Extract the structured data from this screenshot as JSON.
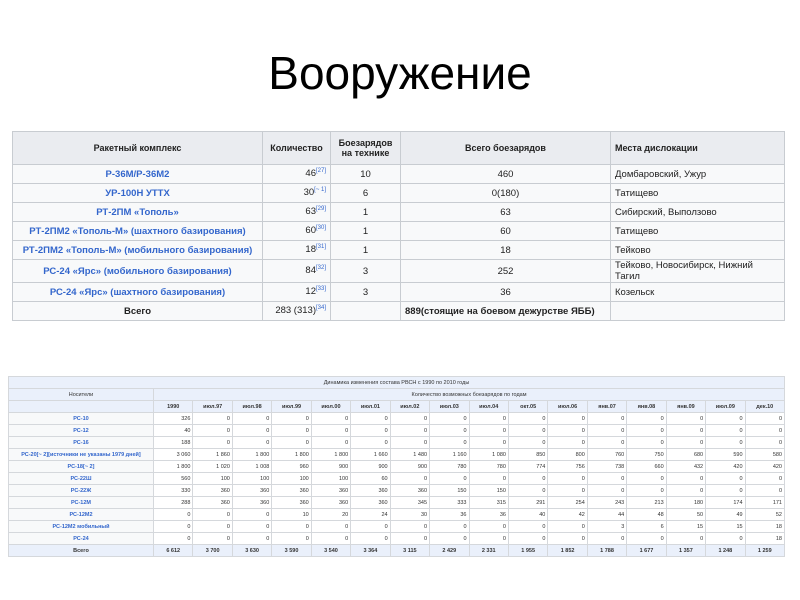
{
  "title": "Вооружение",
  "table1": {
    "headers": [
      "Ракетный комплекс",
      "Количество",
      "Боезарядов на технике",
      "Всего боезарядов",
      "Места дислокации"
    ],
    "rows": [
      {
        "name": "Р-36М/Р-36М2",
        "qty": "46",
        "ref": "[27]",
        "per": "10",
        "total": "460",
        "loc": "Домбаровский, Ужур"
      },
      {
        "name": "УР-100Н УТТХ",
        "qty": "30",
        "ref": "[~ 1]",
        "per": "6",
        "total": "0(180)",
        "loc": "Татищево"
      },
      {
        "name": "РТ-2ПМ «Тополь»",
        "qty": "63",
        "ref": "[29]",
        "per": "1",
        "total": "63",
        "loc": "Сибирский, Выползово"
      },
      {
        "name": "РТ-2ПМ2 «Тополь-М» (шахтного базирования)",
        "qty": "60",
        "ref": "[30]",
        "per": "1",
        "total": "60",
        "loc": "Татищево"
      },
      {
        "name": "РТ-2ПМ2 «Тополь-М» (мобильного базирования)",
        "qty": "18",
        "ref": "[31]",
        "per": "1",
        "total": "18",
        "loc": "Тейково"
      },
      {
        "name": "РС-24 «Ярс» (мобильного базирования)",
        "qty": "84",
        "ref": "[32]",
        "per": "3",
        "total": "252",
        "loc": "Тейково, Новосибирск, Нижний Тагил"
      },
      {
        "name": "РС-24 «Ярс» (шахтного базирования)",
        "qty": "12",
        "ref": "[33]",
        "per": "3",
        "total": "36",
        "loc": "Козельск"
      }
    ],
    "total": {
      "label": "Всего",
      "qty": "283 (313)",
      "ref": "[34]",
      "total": "889(стоящие на боевом дежурстве ЯББ)"
    }
  },
  "table2": {
    "title": "Динамика изменения состава РВСН с 1990 по 2010 годы",
    "carriers_label": "Носители",
    "group_label": "Количество возможных боезарядов по годам",
    "columns": [
      "1990",
      "июл.97",
      "июл.98",
      "июл.99",
      "июл.00",
      "июл.01",
      "июл.02",
      "июл.03",
      "июл.04",
      "окт.05",
      "июл.06",
      "янв.07",
      "янв.08",
      "янв.09",
      "июл.09",
      "дек.10"
    ],
    "rows": [
      {
        "name": "РС-10",
        "values": [
          "326",
          "0",
          "0",
          "0",
          "0",
          "0",
          "0",
          "0",
          "0",
          "0",
          "0",
          "0",
          "0",
          "0",
          "0",
          "0"
        ]
      },
      {
        "name": "РС-12",
        "values": [
          "40",
          "0",
          "0",
          "0",
          "0",
          "0",
          "0",
          "0",
          "0",
          "0",
          "0",
          "0",
          "0",
          "0",
          "0",
          "0"
        ]
      },
      {
        "name": "РС-16",
        "values": [
          "188",
          "0",
          "0",
          "0",
          "0",
          "0",
          "0",
          "0",
          "0",
          "0",
          "0",
          "0",
          "0",
          "0",
          "0",
          "0"
        ]
      },
      {
        "name": "РС-20[~ 2][источники не указаны 1979 дней]",
        "values": [
          "3 060",
          "1 860",
          "1 800",
          "1 800",
          "1 800",
          "1 660",
          "1 480",
          "1 160",
          "1 080",
          "850",
          "800",
          "760",
          "750",
          "680",
          "590",
          "580"
        ]
      },
      {
        "name": "РС-18[~ 2]",
        "values": [
          "1 800",
          "1 020",
          "1 008",
          "960",
          "900",
          "900",
          "900",
          "780",
          "780",
          "774",
          "756",
          "738",
          "660",
          "432",
          "420",
          "420"
        ]
      },
      {
        "name": "РС-22Ш",
        "values": [
          "560",
          "100",
          "100",
          "100",
          "100",
          "60",
          "0",
          "0",
          "0",
          "0",
          "0",
          "0",
          "0",
          "0",
          "0",
          "0"
        ]
      },
      {
        "name": "РС-22Ж",
        "values": [
          "330",
          "360",
          "360",
          "360",
          "360",
          "360",
          "360",
          "150",
          "150",
          "0",
          "0",
          "0",
          "0",
          "0",
          "0",
          "0"
        ]
      },
      {
        "name": "РС-12М",
        "values": [
          "288",
          "360",
          "360",
          "360",
          "360",
          "360",
          "345",
          "333",
          "315",
          "291",
          "254",
          "243",
          "213",
          "180",
          "174",
          "171"
        ]
      },
      {
        "name": "РС-12М2",
        "values": [
          "0",
          "0",
          "0",
          "10",
          "20",
          "24",
          "30",
          "36",
          "36",
          "40",
          "42",
          "44",
          "48",
          "50",
          "49",
          "52"
        ]
      },
      {
        "name": "РС-12М2 мобильный",
        "values": [
          "0",
          "0",
          "0",
          "0",
          "0",
          "0",
          "0",
          "0",
          "0",
          "0",
          "0",
          "3",
          "6",
          "15",
          "15",
          "18"
        ]
      },
      {
        "name": "РС-24",
        "values": [
          "0",
          "0",
          "0",
          "0",
          "0",
          "0",
          "0",
          "0",
          "0",
          "0",
          "0",
          "0",
          "0",
          "0",
          "0",
          "18"
        ]
      }
    ],
    "total": {
      "label": "Всего",
      "values": [
        "6 612",
        "3 700",
        "3 630",
        "3 590",
        "3 540",
        "3 364",
        "3 115",
        "2 429",
        "2 331",
        "1 955",
        "1 852",
        "1 788",
        "1 677",
        "1 357",
        "1 248",
        "1 259"
      ]
    }
  }
}
